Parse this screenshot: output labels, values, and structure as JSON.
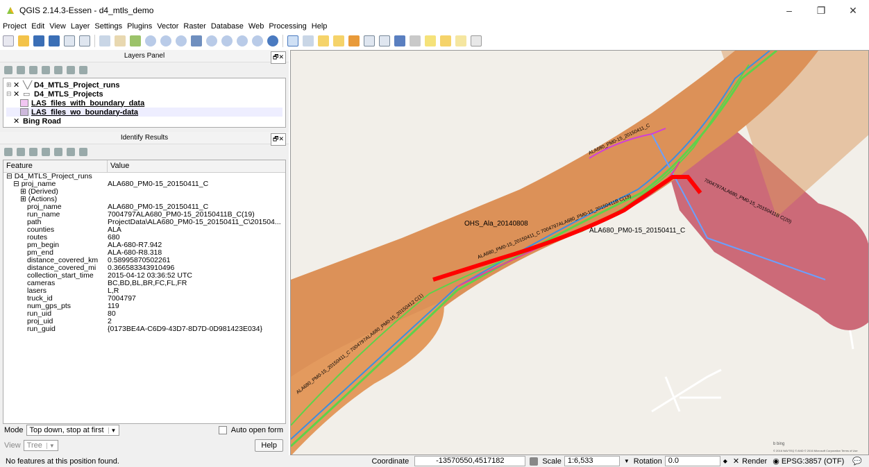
{
  "window": {
    "title": "QGIS 2.14.3-Essen - d4_mtls_demo",
    "minimize": "–",
    "restore": "❐",
    "close": "✕"
  },
  "menu": [
    "Project",
    "Edit",
    "View",
    "Layer",
    "Settings",
    "Plugins",
    "Vector",
    "Raster",
    "Database",
    "Web",
    "Processing",
    "Help"
  ],
  "layers_panel": {
    "title": "Layers Panel",
    "float_btn": "🗗✕",
    "layers": [
      {
        "label": "D4_MTLS_Project_runs",
        "checked": "✕",
        "expand": "⊞"
      },
      {
        "label": "D4_MTLS_Projects",
        "checked": "✕",
        "expand": "⊟"
      },
      {
        "label": "LAS_files_with_boundary_data",
        "color": "#f2c6f2"
      },
      {
        "label": "LAS_files_wo_boundary-data",
        "color": "#cdb8dc"
      },
      {
        "label": "Bing Road",
        "checked": "✕"
      }
    ]
  },
  "identify": {
    "title": "Identify Results",
    "float_btn": "🗗✕",
    "col_feature": "Feature",
    "col_value": "Value",
    "layer": "D4_MTLS_Project_runs",
    "feature_key": "proj_name",
    "feature_val": "ALA680_PM0-15_20150411_C",
    "derived": "(Derived)",
    "actions": "(Actions)",
    "attributes": [
      [
        "proj_name",
        "ALA680_PM0-15_20150411_C"
      ],
      [
        "run_name",
        "7004797ALA680_PM0-15_20150411B_C(19)"
      ],
      [
        "path",
        "ProjectData\\ALA680_PM0-15_20150411_C\\201504..."
      ],
      [
        "counties",
        "ALA"
      ],
      [
        "routes",
        "680"
      ],
      [
        "pm_begin",
        "ALA-680-R7.942"
      ],
      [
        "pm_end",
        "ALA-680-R8.318"
      ],
      [
        "distance_covered_km",
        "0.58995870502261"
      ],
      [
        "distance_covered_mi",
        "0.366583343910496"
      ],
      [
        "collection_start_time",
        "2015-04-12 03:36:52 UTC"
      ],
      [
        "cameras",
        "BC,BD,BL,BR,FC,FL,FR"
      ],
      [
        "lasers",
        "L,R"
      ],
      [
        "truck_id",
        "7004797"
      ],
      [
        "num_gps_pts",
        "119"
      ],
      [
        "run_uid",
        "80"
      ],
      [
        "proj_uid",
        "2"
      ],
      [
        "run_guid",
        "{0173BE4A-C6D9-43D7-8D7D-0D981423E034}"
      ]
    ],
    "mode_label": "Mode",
    "mode_value": "Top down, stop at first",
    "auto_open": "Auto open form",
    "view_label": "View",
    "view_value": "Tree",
    "help": "Help"
  },
  "map": {
    "label_ohs": "OHS_Ala_20140808",
    "label_ala": "ALA680_PM0-15_20150411_C",
    "label_ne": "ALA680_PM0-15_20150411_C",
    "label_right": "7004797ALA680_PM0-15_20150411B C(20)",
    "label_long": "ALA680_PM0-15_20150411_C 7004797ALA680_PM0-15_20150411B C(19)",
    "label_low": "ALA680_PM0-15_20150411_C 7004797ALA680_PM0-15_20150412 C(1)",
    "bing": "b bing",
    "copyright": "© 2016 NAVTEQ © AND © 2016 Microsoft Corporation Terms of Use"
  },
  "status": {
    "message": "No features at this position found.",
    "coord_label": "Coordinate",
    "coord_value": "-13570550,4517182",
    "scale_label": "Scale",
    "scale_value": "1:6,533",
    "rotation_label": "Rotation",
    "rotation_value": "0.0",
    "render_check": "✕",
    "render_label": "Render",
    "crs": "EPSG:3857 (OTF)"
  }
}
